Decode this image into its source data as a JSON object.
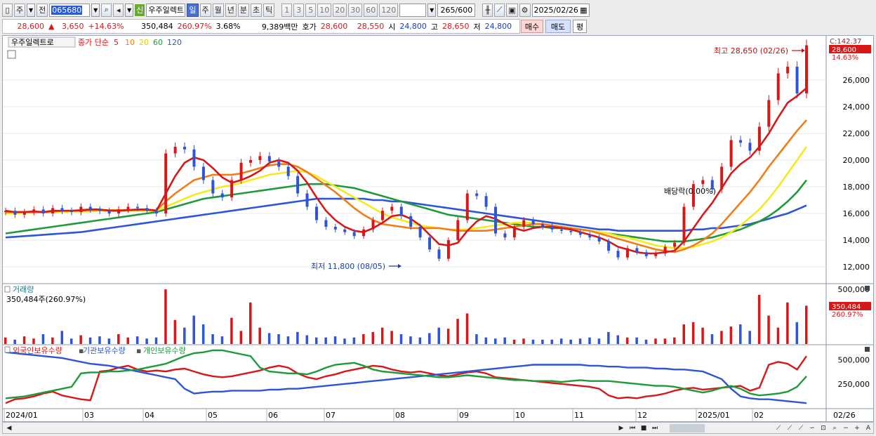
{
  "toolbar": {
    "menu_label": "주",
    "prev_label": "전",
    "stock_code": "065680",
    "new_tag": "신",
    "stock_name": "우주일렉트",
    "period_buttons": [
      "일",
      "주",
      "월",
      "년",
      "분",
      "초",
      "틱"
    ],
    "selected_period": "일",
    "interval_buttons": [
      "1",
      "3",
      "5",
      "10",
      "20",
      "30",
      "60",
      "120"
    ],
    "page_count": "265",
    "page_total": "/600",
    "date": "2025/02/26"
  },
  "quote": {
    "price": "28,600",
    "arrow": "▲",
    "change": "3,650",
    "change_pct": "+14.63%",
    "volume": "350,484",
    "volume_ratio": "260.97%",
    "turnover_pct": "3.68%",
    "amount": "9,389백만",
    "hoga_label": "호가",
    "ask": "28,600",
    "bid": "28,550",
    "open_label": "시",
    "open": "24,800",
    "high_label": "고",
    "high": "28,650",
    "low_label": "저",
    "low": "24,800",
    "buy_label": "매수",
    "sell_label": "매도",
    "avg_label": "평"
  },
  "legend": {
    "name": "우주일렉트로",
    "ma_label": "종가 단순",
    "ma_periods": [
      "5",
      "10",
      "20",
      "60",
      "120"
    ],
    "volume_title": "거래량",
    "volume_value": "350,484주(260.97%)",
    "holdings": [
      "외국인보유수량",
      "기관보유수량",
      "개인보유수량"
    ]
  },
  "annotations": {
    "high": "최고 28,650 (02/26)",
    "low": "최저 11,800 (08/05)",
    "dividend": "배당락(0.00%)",
    "last_price_tag": "28,600",
    "last_pct_tag": "14.63%",
    "top_axis_tag": "C:142.37",
    "vol_tag": "350,484",
    "vol_pct_tag": "260.97%",
    "date_tag": "02/26"
  },
  "chart_data": [
    {
      "type": "candlestick",
      "title": "우주일렉트로",
      "x_ticks": [
        "2024/01",
        "03",
        "04",
        "05",
        "06",
        "07",
        "08",
        "09",
        "10",
        "11",
        "12",
        "2025/01",
        "02"
      ],
      "y_ticks": [
        "12,000",
        "14,000",
        "16,000",
        "18,000",
        "20,000",
        "22,000",
        "24,000",
        "26,000"
      ],
      "ylim": [
        11000,
        29000
      ],
      "close_series": [
        16200,
        15900,
        16100,
        16300,
        16000,
        16400,
        16200,
        16100,
        16500,
        16300,
        16200,
        16000,
        16300,
        16500,
        16400,
        16200,
        16000,
        20500,
        21000,
        20800,
        19500,
        18500,
        17500,
        17200,
        18500,
        19800,
        20000,
        20300,
        19900,
        19500,
        18800,
        17500,
        16500,
        15500,
        15000,
        14800,
        14600,
        14300,
        14800,
        15500,
        16200,
        16500,
        15800,
        15000,
        14200,
        13300,
        12600,
        14000,
        15500,
        17500,
        17300,
        16500,
        14500,
        14200,
        15000,
        15500,
        15200,
        15000,
        14800,
        14700,
        14600,
        14400,
        14200,
        13900,
        13200,
        12700,
        13400,
        13100,
        12800,
        13000,
        13500,
        13800,
        16500,
        18200,
        18500,
        17800,
        19500,
        21500,
        21300,
        20700,
        22500,
        24500,
        26500,
        27000,
        25000,
        28600
      ],
      "ma_series": [
        {
          "name": "5",
          "color": "#d61818",
          "values": [
            16200,
            16100,
            16100,
            16150,
            16100,
            16200,
            16200,
            16200,
            16250,
            16300,
            16300,
            16200,
            16200,
            16250,
            16300,
            16300,
            16200,
            17500,
            18800,
            19800,
            20200,
            20000,
            19400,
            18700,
            18300,
            18500,
            18800,
            19200,
            19800,
            20000,
            19800,
            19200,
            18300,
            17200,
            16200,
            15500,
            15000,
            14700,
            14600,
            14900,
            15300,
            15800,
            15900,
            15600,
            15100,
            14400,
            13700,
            13600,
            13800,
            14700,
            15400,
            15800,
            15600,
            15200,
            14900,
            14700,
            14900,
            15000,
            15000,
            14900,
            14800,
            14600,
            14400,
            14200,
            13900,
            13500,
            13300,
            13100,
            13000,
            13000,
            13100,
            13200,
            13900,
            14900,
            15900,
            16800,
            17900,
            19000,
            19700,
            20200,
            21000,
            22000,
            23200,
            24300,
            24800,
            25400
          ]
        },
        {
          "name": "10",
          "color": "#f07d18",
          "values": [
            16100,
            16100,
            16100,
            16100,
            16100,
            16150,
            16200,
            16200,
            16200,
            16250,
            16250,
            16250,
            16250,
            16250,
            16250,
            16250,
            16250,
            16900,
            17500,
            18000,
            18500,
            18700,
            18900,
            18900,
            18900,
            19000,
            19200,
            19400,
            19600,
            19700,
            19700,
            19500,
            19100,
            18600,
            18100,
            17600,
            17000,
            16400,
            15900,
            15500,
            15200,
            15100,
            15000,
            14900,
            14900,
            14900,
            14900,
            14800,
            14700,
            14700,
            14700,
            14700,
            14800,
            14900,
            15000,
            15100,
            15200,
            15200,
            15100,
            15000,
            14900,
            14800,
            14700,
            14500,
            14300,
            14100,
            13900,
            13700,
            13500,
            13300,
            13200,
            13100,
            13300,
            13600,
            14000,
            14500,
            15200,
            16000,
            16800,
            17600,
            18500,
            19500,
            20400,
            21300,
            22200,
            23000
          ]
        },
        {
          "name": "20",
          "color": "#f5ea20",
          "values": [
            16000,
            16000,
            16050,
            16050,
            16100,
            16100,
            16100,
            16150,
            16150,
            16150,
            16200,
            16200,
            16200,
            16200,
            16200,
            16200,
            16200,
            16500,
            16800,
            17100,
            17400,
            17600,
            17800,
            18000,
            18100,
            18300,
            18500,
            18700,
            18900,
            19000,
            19100,
            19200,
            19100,
            18800,
            18400,
            18000,
            17600,
            17200,
            16800,
            16400,
            16000,
            15700,
            15500,
            15300,
            15100,
            15000,
            14900,
            14800,
            14800,
            14800,
            14900,
            15000,
            15100,
            15200,
            15300,
            15300,
            15300,
            15200,
            15100,
            15000,
            14900,
            14800,
            14700,
            14600,
            14500,
            14300,
            14200,
            14000,
            13800,
            13600,
            13500,
            13400,
            13400,
            13500,
            13700,
            13900,
            14200,
            14600,
            15100,
            15700,
            16300,
            17100,
            18000,
            19000,
            20000,
            21000
          ]
        },
        {
          "name": "60",
          "color": "#1f9a3a",
          "values": [
            14500,
            14600,
            14700,
            14800,
            14900,
            15000,
            15100,
            15200,
            15300,
            15400,
            15500,
            15600,
            15700,
            15800,
            15900,
            16000,
            16100,
            16300,
            16500,
            16700,
            16900,
            17100,
            17200,
            17300,
            17400,
            17500,
            17600,
            17700,
            17800,
            17900,
            18000,
            18100,
            18200,
            18200,
            18200,
            18100,
            18000,
            17900,
            17700,
            17500,
            17300,
            17100,
            16900,
            16700,
            16500,
            16300,
            16100,
            15900,
            15800,
            15700,
            15600,
            15500,
            15400,
            15300,
            15200,
            15100,
            15000,
            15000,
            14900,
            14900,
            14800,
            14800,
            14700,
            14600,
            14500,
            14400,
            14300,
            14200,
            14100,
            14000,
            13900,
            13900,
            13900,
            14000,
            14100,
            14200,
            14400,
            14600,
            14800,
            15100,
            15400,
            15800,
            16300,
            16900,
            17600,
            18500
          ]
        },
        {
          "name": "120",
          "color": "#2d55d6",
          "values": [
            14200,
            14250,
            14300,
            14350,
            14400,
            14450,
            14500,
            14550,
            14600,
            14700,
            14800,
            14900,
            15000,
            15100,
            15200,
            15300,
            15400,
            15500,
            15600,
            15700,
            15800,
            15900,
            16000,
            16100,
            16200,
            16300,
            16400,
            16500,
            16600,
            16700,
            16800,
            16900,
            17000,
            17100,
            17100,
            17100,
            17100,
            17100,
            17100,
            17000,
            17000,
            16900,
            16900,
            16800,
            16700,
            16600,
            16500,
            16400,
            16300,
            16200,
            16100,
            16000,
            15900,
            15800,
            15700,
            15600,
            15500,
            15400,
            15300,
            15200,
            15100,
            15000,
            14900,
            14800,
            14800,
            14700,
            14700,
            14700,
            14700,
            14700,
            14700,
            14700,
            14700,
            14800,
            14800,
            14900,
            14900,
            15000,
            15100,
            15200,
            15400,
            15600,
            15800,
            16000,
            16300,
            16600
          ]
        }
      ]
    },
    {
      "type": "bar",
      "title": "거래량",
      "y_ticks": [
        "500,000"
      ],
      "ylim": [
        0,
        520000
      ],
      "values": [
        60000,
        40000,
        70000,
        50000,
        90000,
        60000,
        120000,
        50000,
        80000,
        60000,
        70000,
        50000,
        90000,
        60000,
        70000,
        50000,
        60000,
        500000,
        220000,
        150000,
        260000,
        180000,
        90000,
        70000,
        240000,
        120000,
        380000,
        150000,
        100000,
        90000,
        70000,
        110000,
        80000,
        60000,
        60000,
        70000,
        50000,
        60000,
        90000,
        110000,
        150000,
        120000,
        90000,
        70000,
        60000,
        100000,
        150000,
        140000,
        230000,
        280000,
        90000,
        60000,
        50000,
        60000,
        40000,
        50000,
        40000,
        40000,
        40000,
        50000,
        40000,
        50000,
        60000,
        50000,
        110000,
        80000,
        60000,
        60000,
        40000,
        50000,
        50000,
        60000,
        180000,
        200000,
        150000,
        90000,
        120000,
        160000,
        180000,
        120000,
        450000,
        260000,
        150000,
        380000,
        200000,
        350484
      ]
    },
    {
      "type": "line",
      "title": "보유수량",
      "y_ticks": [
        "500,000",
        "250,000"
      ],
      "ylim": [
        0,
        600000
      ],
      "series": [
        {
          "name": "외국인보유수량",
          "color": "#d61818",
          "values": [
            50000,
            90000,
            100000,
            120000,
            150000,
            170000,
            130000,
            110000,
            90000,
            80000,
            380000,
            390000,
            420000,
            440000,
            400000,
            380000,
            390000,
            380000,
            400000,
            410000,
            380000,
            350000,
            330000,
            320000,
            330000,
            350000,
            370000,
            390000,
            420000,
            440000,
            420000,
            360000,
            320000,
            300000,
            330000,
            350000,
            380000,
            400000,
            420000,
            440000,
            430000,
            400000,
            380000,
            370000,
            380000,
            360000,
            340000,
            330000,
            350000,
            370000,
            380000,
            360000,
            320000,
            310000,
            300000,
            290000,
            280000,
            270000,
            260000,
            250000,
            240000,
            230000,
            220000,
            200000,
            130000,
            100000,
            110000,
            100000,
            120000,
            130000,
            150000,
            180000,
            200000,
            210000,
            190000,
            200000,
            210000,
            220000,
            230000,
            180000,
            210000,
            450000,
            480000,
            460000,
            400000,
            540000
          ]
        },
        {
          "name": "기관보유수량",
          "color": "#2d55d6",
          "values": [
            580000,
            570000,
            560000,
            550000,
            540000,
            530000,
            520000,
            500000,
            480000,
            460000,
            450000,
            440000,
            420000,
            400000,
            380000,
            360000,
            340000,
            320000,
            300000,
            200000,
            150000,
            160000,
            170000,
            170000,
            180000,
            180000,
            180000,
            180000,
            190000,
            190000,
            200000,
            200000,
            210000,
            220000,
            230000,
            240000,
            250000,
            260000,
            270000,
            280000,
            290000,
            300000,
            310000,
            320000,
            330000,
            340000,
            350000,
            360000,
            370000,
            380000,
            390000,
            400000,
            410000,
            420000,
            430000,
            440000,
            450000,
            450000,
            450000,
            450000,
            450000,
            450000,
            440000,
            440000,
            430000,
            430000,
            420000,
            420000,
            420000,
            410000,
            410000,
            400000,
            400000,
            390000,
            380000,
            340000,
            300000,
            200000,
            120000,
            100000,
            90000,
            90000,
            80000,
            70000,
            60000,
            50000
          ]
        },
        {
          "name": "개인보유수량",
          "color": "#1f9a3a",
          "values": [
            100000,
            110000,
            120000,
            140000,
            160000,
            180000,
            200000,
            220000,
            360000,
            370000,
            370000,
            380000,
            380000,
            390000,
            400000,
            420000,
            440000,
            460000,
            500000,
            540000,
            570000,
            580000,
            600000,
            600000,
            580000,
            560000,
            540000,
            420000,
            380000,
            370000,
            360000,
            360000,
            350000,
            380000,
            420000,
            450000,
            460000,
            470000,
            440000,
            400000,
            380000,
            370000,
            360000,
            350000,
            340000,
            330000,
            320000,
            320000,
            330000,
            340000,
            330000,
            320000,
            310000,
            300000,
            290000,
            290000,
            280000,
            280000,
            280000,
            270000,
            280000,
            290000,
            280000,
            280000,
            280000,
            270000,
            260000,
            250000,
            240000,
            230000,
            230000,
            220000,
            200000,
            180000,
            160000,
            180000,
            210000,
            230000,
            200000,
            150000,
            130000,
            140000,
            150000,
            170000,
            220000,
            330000
          ]
        }
      ]
    }
  ]
}
